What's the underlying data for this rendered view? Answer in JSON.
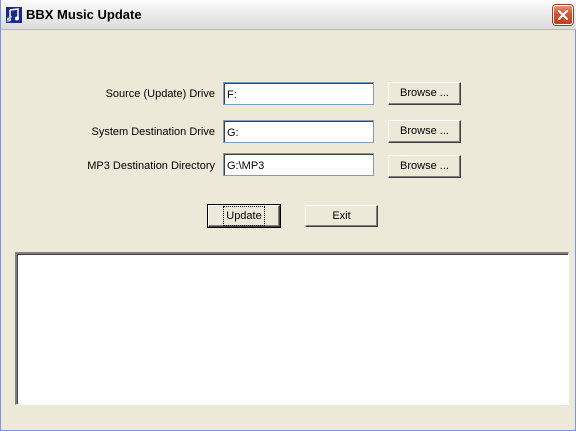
{
  "window": {
    "title": "BBX Music Update",
    "icon": "music-app-icon",
    "close_icon": "close-icon"
  },
  "form": {
    "rows": [
      {
        "label": "Source (Update) Drive",
        "value": "F:",
        "browse_label": "Browse ..."
      },
      {
        "label": "System Destination Drive",
        "value": "G:",
        "browse_label": "Browse ..."
      },
      {
        "label": "MP3 Destination Directory",
        "value": "G:\\MP3",
        "browse_label": "Browse ..."
      }
    ]
  },
  "actions": {
    "update_label": "Update",
    "exit_label": "Exit"
  },
  "log": {
    "content": ""
  },
  "colors": {
    "face": "#ece9d8",
    "close_red": "#d5512f",
    "textbox_border": "#7f9db9"
  }
}
